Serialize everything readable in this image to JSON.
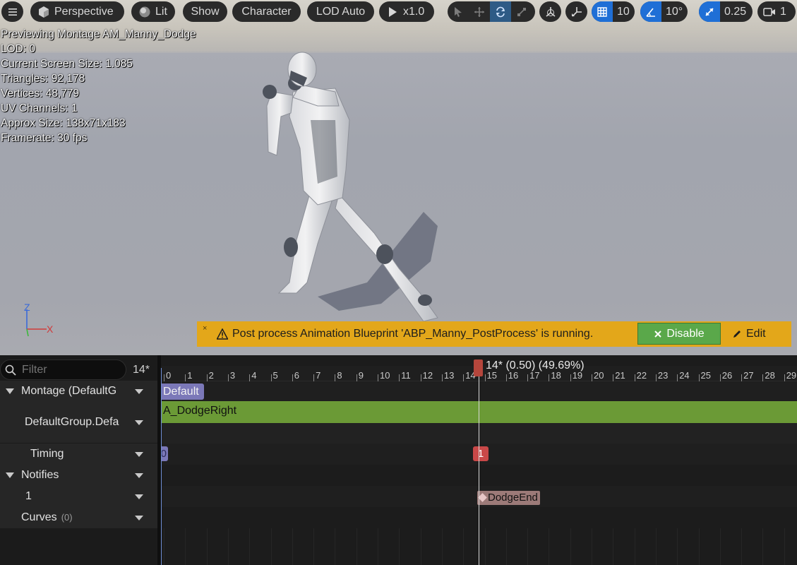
{
  "toolbar": {
    "perspective_label": "Perspective",
    "lit_label": "Lit",
    "show_label": "Show",
    "character_label": "Character",
    "lod_label": "LOD Auto",
    "play_speed_label": "x1.0",
    "grid_snap_value": "10",
    "rotation_snap_value": "10°",
    "scale_snap_value": "0.25",
    "camera_speed_value": "1"
  },
  "stats": {
    "line1": "Previewing Montage AM_Manny_Dodge",
    "line2": "LOD: 0",
    "line3": "Current Screen Size: 1.085",
    "line4": "Triangles: 92,178",
    "line5": "Vertices: 48,779",
    "line6": "UV Channels: 1",
    "line7": "Approx Size: 138x71x183",
    "line8": "Framerate: 30 fps"
  },
  "axis": {
    "z": "Z",
    "x": "X"
  },
  "notice": {
    "close": "×",
    "message": "Post process Animation Blueprint 'ABP_Manny_PostProcess' is running.",
    "disable_label": "Disable",
    "edit_label": "Edit"
  },
  "panel": {
    "filter_placeholder": "Filter",
    "frame_count": "14*",
    "rows": {
      "montage": "Montage (DefaultG",
      "default_group": "DefaultGroup.Defa",
      "timing": "Timing",
      "notifies": "Notifies",
      "notify_track": "1",
      "curves": "Curves",
      "curves_count": "(0)"
    }
  },
  "timeline": {
    "playhead_label": "14* (0.50) (49.69%)",
    "ticks": [
      "0",
      "1",
      "2",
      "3",
      "4",
      "5",
      "6",
      "7",
      "8",
      "9",
      "10",
      "11",
      "12",
      "13",
      "14",
      "15",
      "16",
      "17",
      "18",
      "19",
      "20",
      "21",
      "22",
      "23",
      "24",
      "25",
      "26",
      "27",
      "28",
      "29"
    ],
    "section_label": "Default",
    "segment_label": "A_DodgeRight",
    "timing_start": "0",
    "timing_marker": "1",
    "notify_label": "DodgeEnd"
  },
  "colors": {
    "segment": "#6b9a36",
    "section": "#7b78b8",
    "notice": "#e3a71a",
    "disable": "#5aa84a",
    "playhead": "#b5463c"
  }
}
